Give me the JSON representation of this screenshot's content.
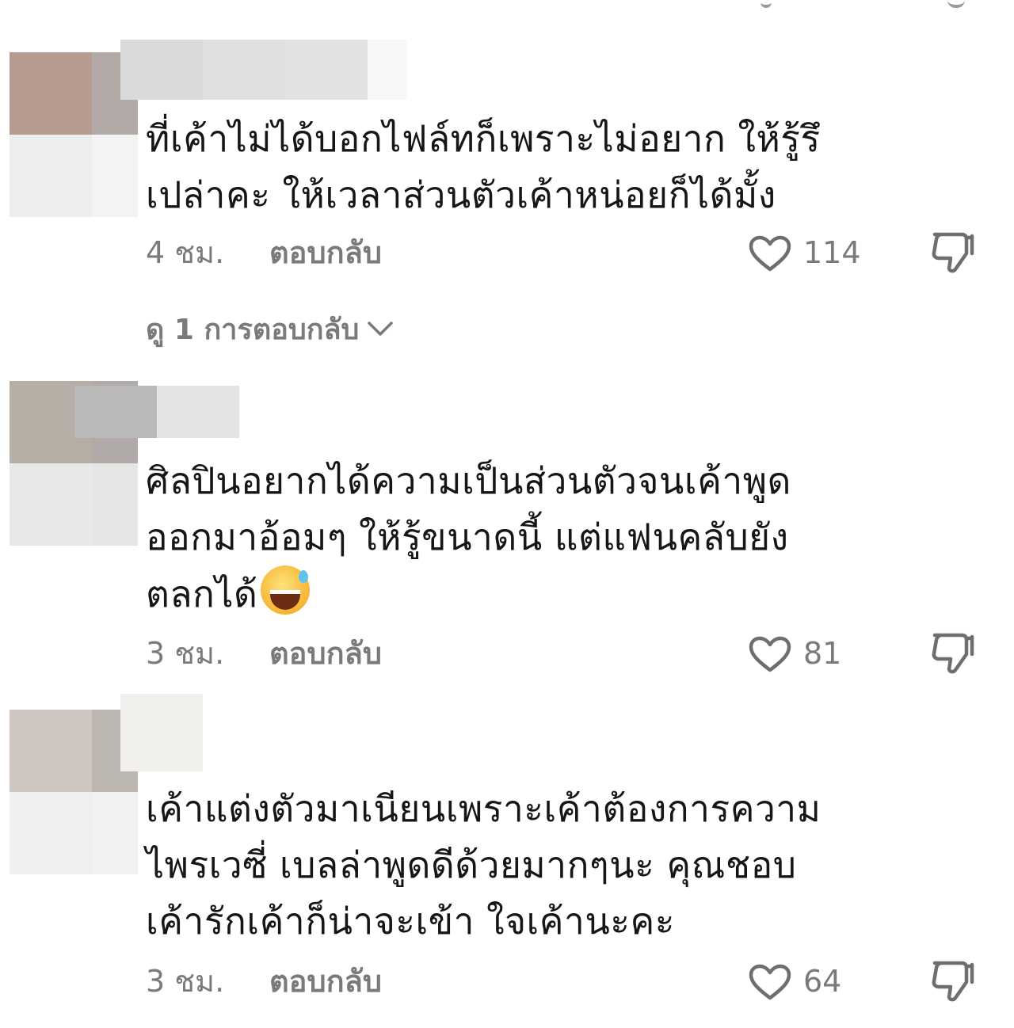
{
  "colors": {
    "text": "#161616",
    "muted": "#7a7a7a",
    "background": "#ffffff"
  },
  "icons": {
    "like": "heart-outline-icon",
    "dislike": "thumbs-down-outline-icon",
    "expand": "chevron-down-icon"
  },
  "comments": [
    {
      "text_lines": [
        "ที่เค้าไม่ได้บอกไฟล์ทก็เพราะไม่อยาก ให้รู้รึ",
        "เปล่าคะ ให้เวลาส่วนตัวเค้าหน่อยก็ได้มั้ง"
      ],
      "time": "4 ชม.",
      "reply_label": "ตอบกลับ",
      "likes": "114",
      "view_replies": "ดู 1 การตอบกลับ"
    },
    {
      "text_lines": [
        "ศิลปินอยากได้ความเป็นส่วนตัวจนเค้าพูด",
        "ออกมาอ้อมๆ ให้รู้ขนาดนี้ แต่แฟนคลับยัง",
        "ตลกได้"
      ],
      "emoji": "grinning-sweat-emoji",
      "time": "3 ชม.",
      "reply_label": "ตอบกลับ",
      "likes": "81"
    },
    {
      "text_lines": [
        "เค้าแต่งตัวมาเนียนเพราะเค้าต้องการความ",
        "ไพรเวซี่ เบลล่าพูดดีด้วยมากๆนะ คุณชอบ",
        "เค้ารักเค้าก็น่าจะเข้า ใจเค้านะคะ"
      ],
      "time": "3 ชม.",
      "reply_label": "ตอบกลับ",
      "likes": "64"
    }
  ]
}
